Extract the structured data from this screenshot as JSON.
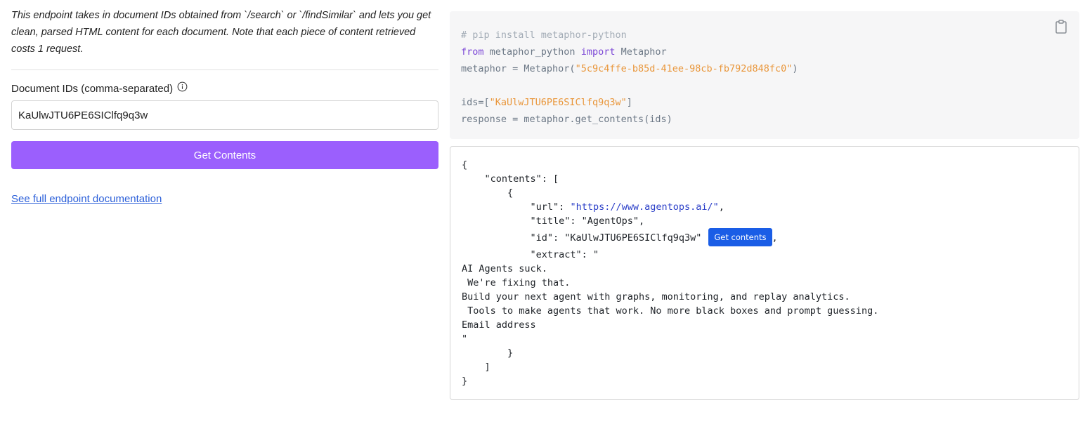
{
  "left": {
    "description": "This endpoint takes in document IDs obtained from `/search` or `/findSimilar` and lets you get clean, parsed HTML content for each document. Note that each piece of content retrieved costs 1 request.",
    "field_label": "Document IDs (comma-separated)",
    "input_value": "KaUlwJTU6PE6SIClfq9q3w",
    "submit_label": "Get Contents",
    "doc_link_label": "See full endpoint documentation"
  },
  "code": {
    "line1_comment": "# pip install metaphor-python",
    "line2_from": "from",
    "line2_module": " metaphor_python ",
    "line2_import": "import",
    "line2_class": " Metaphor",
    "line3_prefix": "metaphor = Metaphor(",
    "line3_key": "\"5c9c4ffe-b85d-41ee-98cb-fb792d848fc0\"",
    "line3_suffix": ")",
    "line5_prefix": "ids=[",
    "line5_id": "\"KaUlwJTU6PE6SIClfq9q3w\"",
    "line5_suffix": "]",
    "line6": "response = metaphor.get_contents(ids)"
  },
  "response": {
    "l1": "{",
    "l2": "    \"contents\": [",
    "l3": "        {",
    "l4_key": "            \"url\": ",
    "l4_val": "\"https://www.agentops.ai/\"",
    "l4_tail": ",",
    "l5": "            \"title\": \"AgentOps\",",
    "l6_key": "            \"id\": \"KaUlwJTU6PE6SIClfq9q3w\"",
    "l6_button": "Get contents",
    "l6_tail": ",",
    "l7": "            \"extract\": \"",
    "l8": "AI Agents suck.",
    "l9": " We're fixing that.",
    "l10": "Build your next agent with graphs, monitoring, and replay analytics.",
    "l11": " Tools to make agents that work. No more black boxes and prompt guessing.",
    "l12": "Email address",
    "l13": "\"",
    "l14": "        }",
    "l15": "    ]",
    "l16": "}"
  },
  "colors": {
    "primary_button": "#9b5ffd",
    "link": "#2b5fd9",
    "inline_button": "#1a5de6",
    "keyword": "#7b46d6",
    "string": "#e9963a"
  },
  "icons": {
    "info": "info-circle-icon",
    "copy": "clipboard-icon"
  }
}
